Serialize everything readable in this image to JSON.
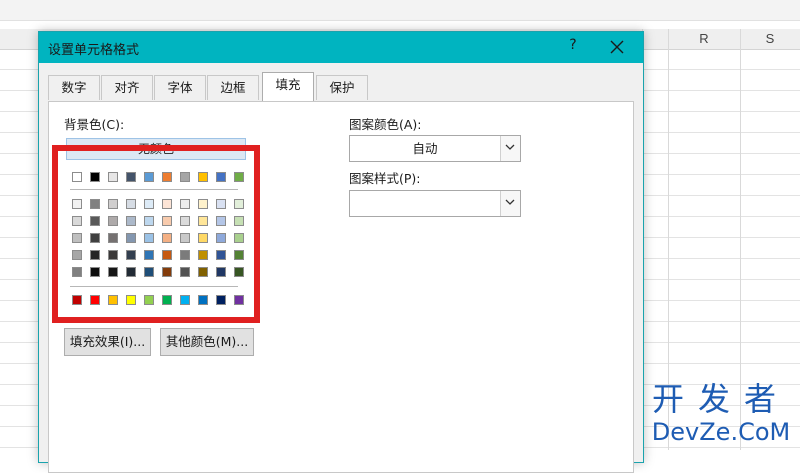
{
  "spreadsheet": {
    "columns": [
      "R",
      "S"
    ]
  },
  "dialog": {
    "title": "设置单元格格式",
    "help": "?",
    "close": "✕",
    "tabs": [
      {
        "label": "数字"
      },
      {
        "label": "对齐"
      },
      {
        "label": "字体"
      },
      {
        "label": "边框"
      },
      {
        "label": "填充",
        "active": true
      },
      {
        "label": "保护"
      }
    ],
    "background_color_label": "背景色(C):",
    "no_color_label": "无颜色",
    "fill_effects_label": "填充效果(I)...",
    "more_colors_label": "其他颜色(M)...",
    "pattern_color_label": "图案颜色(A):",
    "pattern_color_value": "自动",
    "pattern_style_label": "图案样式(P):",
    "pattern_style_value": ""
  },
  "palette": {
    "theme_top": [
      "#ffffff",
      "#000000",
      "#e7e6e6",
      "#44546a",
      "#5b9bd5",
      "#ed7d31",
      "#a5a5a5",
      "#ffc000",
      "#4472c4",
      "#70ad47"
    ],
    "theme_shades": [
      [
        "#f2f2f2",
        "#808080",
        "#d0cece",
        "#d6dce4",
        "#ddebf7",
        "#fce4d6",
        "#ededed",
        "#fff2cc",
        "#d9e1f2",
        "#e2efda"
      ],
      [
        "#d9d9d9",
        "#595959",
        "#aeaaaa",
        "#acb9ca",
        "#bdd7ee",
        "#f8cbad",
        "#dbdbdb",
        "#ffe699",
        "#b4c6e7",
        "#c6e0b4"
      ],
      [
        "#bfbfbf",
        "#404040",
        "#757171",
        "#8497b0",
        "#9bc2e6",
        "#f4b084",
        "#c9c9c9",
        "#ffd966",
        "#8ea9db",
        "#a9d08e"
      ],
      [
        "#a6a6a6",
        "#262626",
        "#3a3838",
        "#333f4f",
        "#2f75b5",
        "#c65911",
        "#7b7b7b",
        "#bf8f00",
        "#305496",
        "#548235"
      ],
      [
        "#808080",
        "#0d0d0d",
        "#161616",
        "#222b35",
        "#1f4e78",
        "#833c0b",
        "#525252",
        "#806000",
        "#203764",
        "#375623"
      ]
    ],
    "standard": [
      "#c00000",
      "#ff0000",
      "#ffc000",
      "#ffff00",
      "#92d050",
      "#00b050",
      "#00b0f0",
      "#0070c0",
      "#002060",
      "#7030a0"
    ]
  },
  "colors": {
    "titlebar": "#00b4c0",
    "highlight_box": "#e02020",
    "watermark": "#1e5cb3"
  },
  "watermark": {
    "line1": "开发者",
    "line2": "DevZe.CoM"
  }
}
